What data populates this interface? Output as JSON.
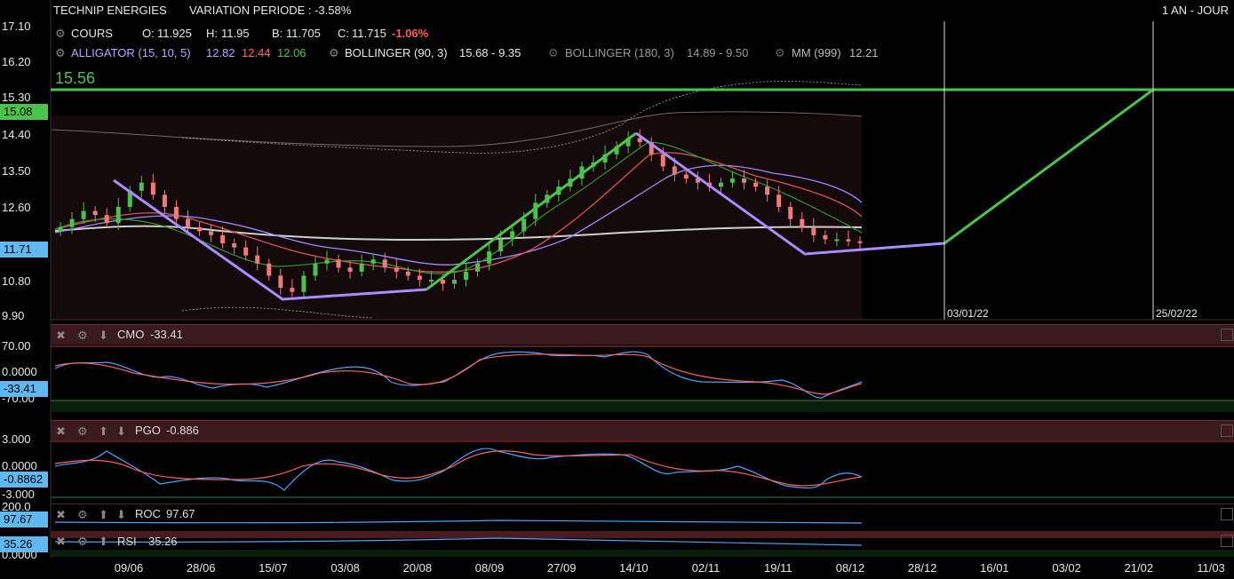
{
  "header": {
    "title": "TECHNIP ENERGIES",
    "variation": "VARIATION PERIODE : -3.58%",
    "period": "1 AN - JOUR"
  },
  "legend": {
    "cours": {
      "name": "COURS",
      "o_label": "O:",
      "o": "11.925",
      "h_label": "H:",
      "h": "11.95",
      "b_label": "B:",
      "b": "11.705",
      "c_label": "C:",
      "c": "11.715",
      "chg": "-1.06%"
    },
    "alligator": {
      "name": "ALLIGATOR (15, 10, 5)",
      "v1": "12.82",
      "v2": "12.44",
      "v3": "12.06"
    },
    "bollinger1": {
      "name": "BOLLINGER (90, 3)",
      "value": "15.68 - 9.35"
    },
    "bollinger2": {
      "name": "BOLLINGER (180, 3)",
      "value": "14.89 - 9.50"
    },
    "mm": {
      "name": "MM (999)",
      "value": "12.21"
    }
  },
  "price_axis": {
    "ticks": [
      "17.10",
      "16.20",
      "15.30",
      "14.40",
      "13.50",
      "12.60",
      "10.80",
      "9.90"
    ],
    "tag_green": "15.08",
    "tag_blue": "11.71",
    "level_label": "15.56"
  },
  "date_markers": [
    "03/01/22",
    "25/02/22"
  ],
  "x_axis": {
    "ticks": [
      "09/06",
      "28/06",
      "15/07",
      "03/08",
      "20/08",
      "08/09",
      "27/09",
      "14/10",
      "02/11",
      "19/11",
      "08/12",
      "28/12",
      "16/01",
      "03/02",
      "21/02",
      "11/03"
    ]
  },
  "panels": {
    "cmo": {
      "label": "CMO",
      "value": "-33.41",
      "ticks": [
        "70.00",
        "0.0000",
        "-70.00"
      ],
      "tag": "-33.41"
    },
    "pgo": {
      "label": "PGO",
      "value": "-0.886",
      "ticks": [
        "3.000",
        "0.0000",
        "-3.000"
      ],
      "tag": "-0.8862"
    },
    "roc": {
      "label": "ROC",
      "value": "97.67",
      "ticks": [
        "200.0"
      ],
      "tag": "97.67"
    },
    "rsi": {
      "label": "RSI",
      "value": "35.26",
      "ticks": [
        "0.0000"
      ],
      "tag": "35.26"
    }
  },
  "colors": {
    "green": "#4cc44c",
    "purple": "#a98cff",
    "blue_tag": "#5fb8ef",
    "red": "#ff5a5a",
    "candle_up": "#4ec04e",
    "candle_down": "#f07a7a"
  },
  "chart_data": {
    "type": "candlestick",
    "y_range": [
      9.9,
      17.1
    ],
    "x_range": [
      "2021-06",
      "2022-03"
    ],
    "level_line": 15.56,
    "last_close": 11.715,
    "close_series": [
      12.1,
      12.3,
      12.5,
      12.4,
      12.2,
      12.6,
      13.0,
      13.2,
      12.9,
      12.6,
      12.3,
      12.1,
      12.0,
      11.9,
      11.7,
      11.6,
      11.4,
      11.2,
      10.9,
      10.6,
      10.5,
      10.9,
      11.2,
      11.3,
      11.1,
      11.0,
      11.2,
      11.3,
      11.1,
      11.0,
      10.9,
      10.8,
      10.8,
      10.7,
      10.8,
      11.0,
      11.2,
      11.5,
      11.8,
      12.0,
      12.3,
      12.7,
      12.9,
      13.1,
      13.3,
      13.6,
      13.7,
      13.9,
      14.1,
      14.3,
      14.2,
      13.9,
      13.6,
      13.4,
      13.3,
      13.2,
      13.1,
      13.2,
      13.3,
      13.2,
      13.1,
      12.9,
      12.6,
      12.3,
      12.1,
      11.9,
      11.8,
      11.8,
      11.75,
      11.715
    ]
  }
}
